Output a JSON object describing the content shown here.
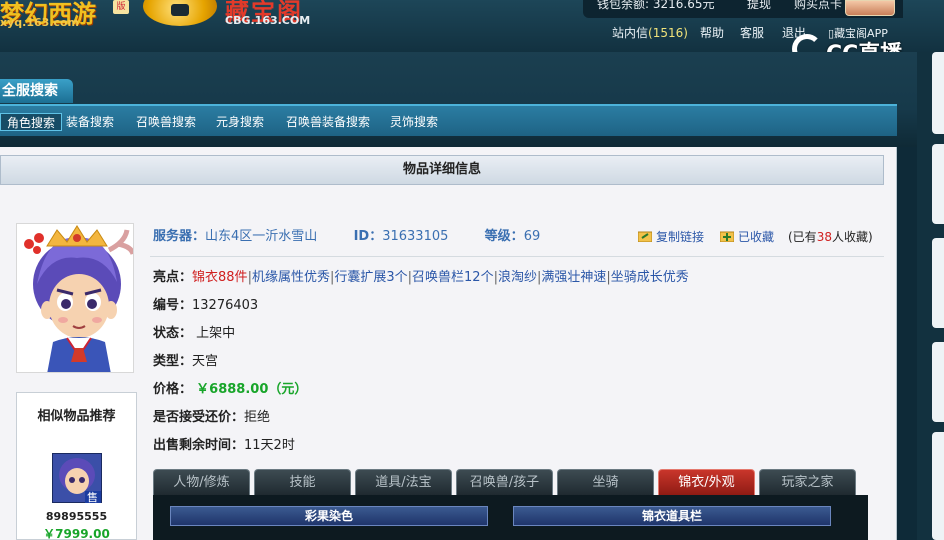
{
  "header": {
    "game_logo_text": "梦幻西游",
    "game_logo_tag": "版",
    "game_url": "xyq.163.com",
    "cbg_name": "藏宝阁",
    "cbg_domain": "CBG.163.COM",
    "balance_label": "钱包余额: 3216.65元",
    "withdraw": "提现",
    "buy_points": "购买点卡"
  },
  "user_links": {
    "inbox_label": "站内信",
    "inbox_count": "(1516)",
    "help": "帮助",
    "support": "客服",
    "logout": "退出",
    "app": "藏宝阁APP"
  },
  "overlay_logo": "CC直播",
  "nav": {
    "all_search": "全服搜索",
    "items": [
      {
        "label": "角色搜索",
        "active": true
      },
      {
        "label": "装备搜索"
      },
      {
        "label": "召唤兽搜索"
      },
      {
        "label": "元身搜索"
      },
      {
        "label": "召唤兽装备搜索"
      },
      {
        "label": "灵饰搜索"
      }
    ]
  },
  "detail": {
    "title": "物品详细信息",
    "server_label": "服务器：",
    "server_value": "山东4区一沂水雪山",
    "id_label": "ID：",
    "id_value": "31633105",
    "level_label": "等级：",
    "level_value": "69",
    "copy_link": "复制链接",
    "favorited": "已收藏",
    "fav_prefix": "(已有",
    "fav_count": "38",
    "fav_suffix": "人收藏)",
    "highlights_label": "亮点：",
    "highlights": [
      "锦衣88件",
      "机缘属性优秀",
      "行囊扩展3个",
      "召唤兽栏12个",
      "浪淘纱",
      "满强壮神速",
      "坐骑成长优秀"
    ],
    "number_label": "编号：",
    "number_value": "13276403",
    "status_label": "状态：",
    "status_value": "上架中",
    "type_label": "类型：",
    "type_value": "天宫",
    "price_label": "价格：",
    "price_value": "￥6888.00（元）",
    "bargain_label": "是否接受还价：",
    "bargain_value": "拒绝",
    "time_label": "出售剩余时间：",
    "time_value": "11天2时"
  },
  "similar": {
    "title": "相似物品推荐",
    "badge": "售",
    "id": "89895555",
    "price": "￥7999.00"
  },
  "tabs": [
    {
      "label": "人物/修炼"
    },
    {
      "label": "技能"
    },
    {
      "label": "道具/法宝"
    },
    {
      "label": "召唤兽/孩子"
    },
    {
      "label": "坐骑"
    },
    {
      "label": "锦衣/外观",
      "active": true
    },
    {
      "label": "玩家之家"
    }
  ],
  "tab_content": {
    "left_header": "彩果染色",
    "right_header": "锦衣道具栏"
  },
  "colors": {
    "accent_blue": "#2b7da3",
    "active_tab_red": "#c9362b",
    "price_green": "#18a52a",
    "link_blue": "#2b57a8"
  }
}
